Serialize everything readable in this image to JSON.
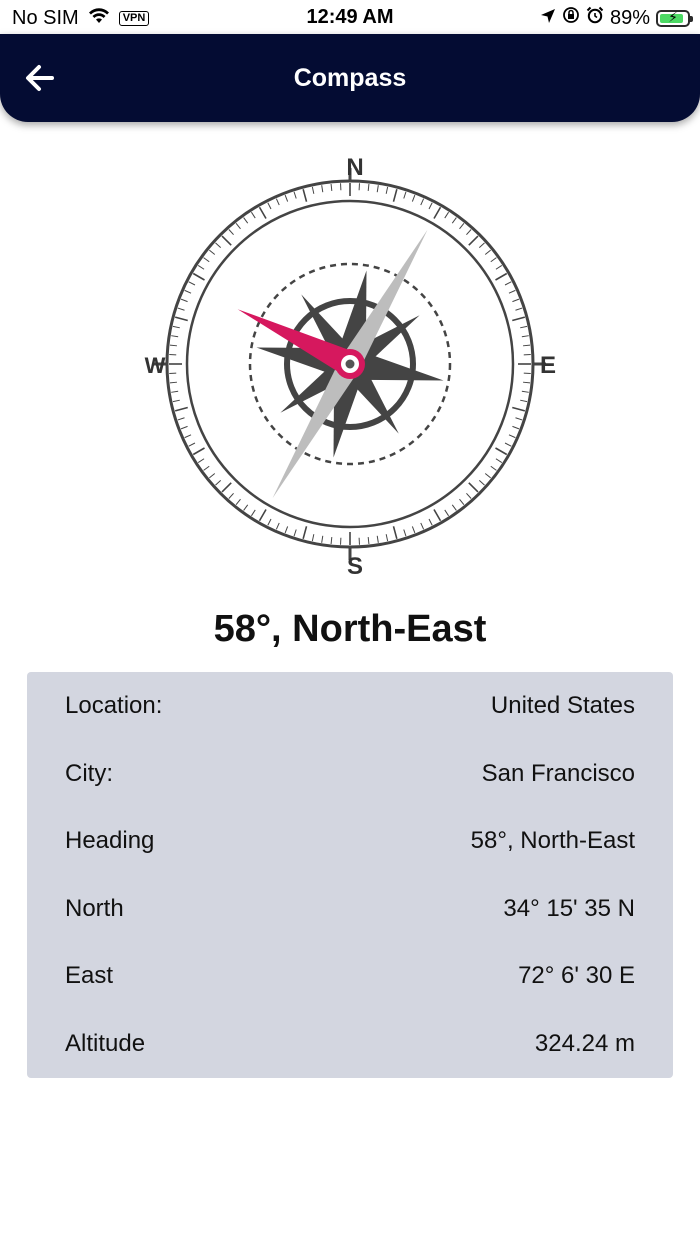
{
  "status_bar": {
    "carrier": "No SIM",
    "vpn_label": "VPN",
    "time": "12:49 AM",
    "battery_percent": "89%",
    "battery_level": 0.89,
    "icons": [
      "wifi-icon",
      "vpn-icon",
      "location-arrow-icon",
      "orientation-lock-icon",
      "alarm-icon",
      "battery-charging-icon"
    ]
  },
  "header": {
    "title": "Compass",
    "back_icon": "arrow-left-icon"
  },
  "compass": {
    "north": "N",
    "east": "E",
    "south": "S",
    "west": "W",
    "heading_degrees": 58,
    "needle_color": "#d6185e",
    "rose_color": "#444444"
  },
  "heading_display": "58°, North-East",
  "info": [
    {
      "label": "Location:",
      "value": "United States"
    },
    {
      "label": "City:",
      "value": "San Francisco"
    },
    {
      "label": "Heading",
      "value": "58°, North-East"
    },
    {
      "label": "North",
      "value": "34° 15' 35 N"
    },
    {
      "label": "East",
      "value": "72° 6' 30 E"
    },
    {
      "label": "Altitude",
      "value": "324.24 m"
    }
  ],
  "colors": {
    "header_bg": "#040c33",
    "card_bg": "#d3d6e0"
  }
}
